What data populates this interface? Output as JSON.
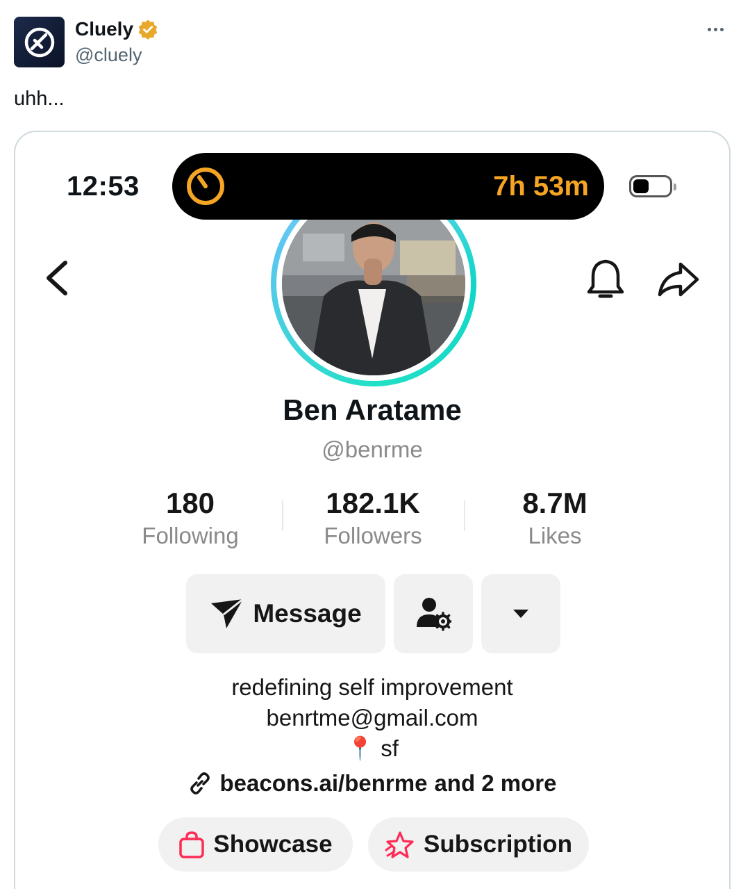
{
  "tweet": {
    "author_name": "Cluely",
    "author_handle": "@cluely",
    "text": "uhh...",
    "verified_color": "#e8a82b"
  },
  "phone": {
    "time": "12:53",
    "timer": "7h 53m",
    "accent_color": "#f5a524"
  },
  "profile": {
    "name": "Ben Aratame",
    "handle": "@benrme",
    "stats": [
      {
        "value": "180",
        "label": "Following"
      },
      {
        "value": "182.1K",
        "label": "Followers"
      },
      {
        "value": "8.7M",
        "label": "Likes"
      }
    ],
    "message_label": "Message",
    "bio": [
      "redefining self improvement",
      "benrtme@gmail.com",
      "sf"
    ],
    "link_text": "beacons.ai/benrme",
    "link_more": "and 2 more",
    "showcase_label": "Showcase",
    "subscription_label": "Subscription",
    "pin_emoji": "📍",
    "pill_icon_color": "#fe2c55",
    "ring_colors": [
      "#10d6c8",
      "#5cc6f0"
    ]
  },
  "icons": [
    "more-icon",
    "back-icon",
    "bell-icon",
    "share-icon",
    "send-icon",
    "person-gear-icon",
    "caret-down-icon",
    "link-icon",
    "pin-icon",
    "bag-icon",
    "star-icon",
    "timer-icon",
    "battery-icon",
    "verified-badge-icon",
    "cluely-logo"
  ]
}
